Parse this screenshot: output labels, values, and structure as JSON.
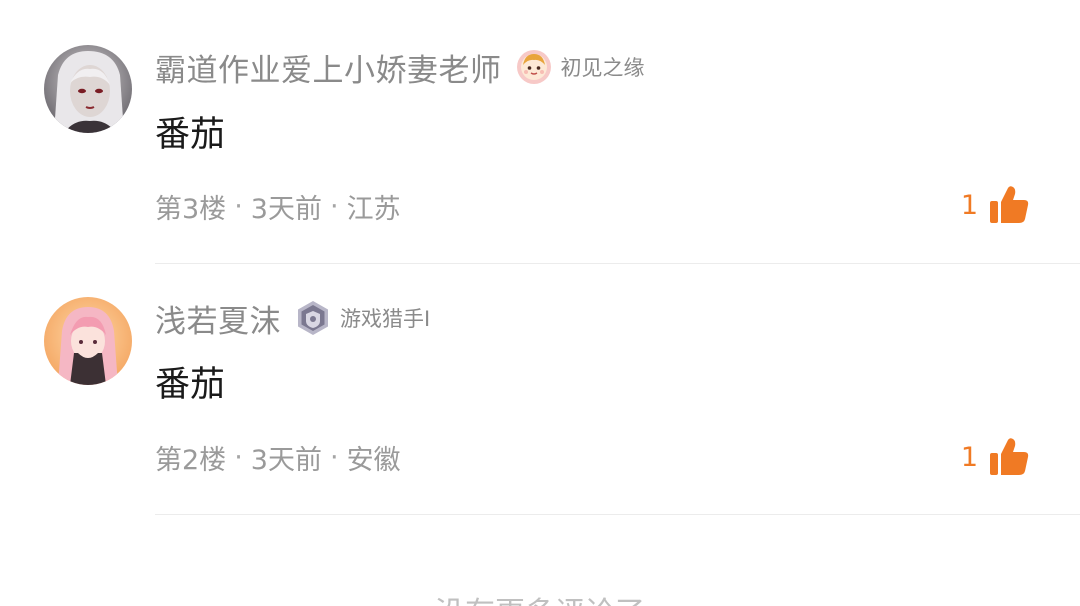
{
  "comments": [
    {
      "username": "霸道作业爱上小娇妻老师",
      "badge_label": "初见之缘",
      "badge_icon": "cartoon-avatar-badge-icon",
      "text": "番茄",
      "floor": "第3楼",
      "time": "3天前",
      "location": "江苏",
      "likes": "1",
      "avatar_icon": "user-avatar-dark-hair"
    },
    {
      "username": "浅若夏沫",
      "badge_label": "游戏猎手I",
      "badge_icon": "shield-hexagon-badge-icon",
      "text": "番茄",
      "floor": "第2楼",
      "time": "3天前",
      "location": "安徽",
      "likes": "1",
      "avatar_icon": "user-avatar-pink-hair"
    }
  ],
  "meta_separator": "·",
  "footer": {
    "no_more_text": "没有更多评论了"
  },
  "colors": {
    "accent": "#f07a24",
    "username": "#8a8a8a",
    "meta": "#9a9a9a",
    "body_text": "#1a1a1a"
  }
}
